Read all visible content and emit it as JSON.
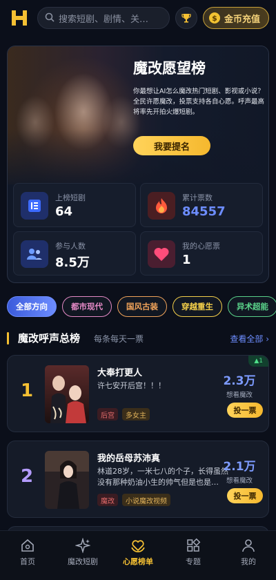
{
  "header": {
    "search_placeholder": "搜索短剧、剧情、关…",
    "coin_icon_text": "$",
    "coin_button_label": "金币充值"
  },
  "hero": {
    "title": "魔改愿望榜",
    "description": "你最想让AI怎么魔改热门短剧、影视或小说？全民许愿魔改，投票支持各自心愿。呼声最高将率先开拍火爆短剧。",
    "cta_label": "我要提名",
    "stats": [
      {
        "label": "上榜短剧",
        "value": "64",
        "icon": "list-icon"
      },
      {
        "label": "累计票数",
        "value": "84557",
        "icon": "fire-icon"
      },
      {
        "label": "参与人数",
        "value": "8.5万",
        "icon": "users-icon"
      },
      {
        "label": "我的心愿票",
        "value": "1",
        "icon": "heart-icon"
      }
    ]
  },
  "filters": {
    "chips": [
      {
        "label": "全部方向",
        "color": "#6d8dff"
      },
      {
        "label": "都市现代",
        "color": "#e58ac6"
      },
      {
        "label": "国风古装",
        "color": "#f0a35a"
      },
      {
        "label": "穿越重生",
        "color": "#f5d04a"
      },
      {
        "label": "异术超能",
        "color": "#5ad38a"
      }
    ],
    "selected": "全部方向"
  },
  "section": {
    "title": "魔改呼声总榜",
    "subtitle": "每条每天一票",
    "more_label": "查看全部",
    "more_arrow": "›"
  },
  "rankings": [
    {
      "rank": "1",
      "title": "大奉打更人",
      "description": "许七安开后宫！！！",
      "tags": [
        {
          "label": "后宫",
          "color": "#e06a6a",
          "bg": "#3a1c22"
        },
        {
          "label": "多女主",
          "color": "#e0b25a",
          "bg": "#3a2e1a"
        }
      ],
      "votes": "2.3万",
      "votes_label": "想看魔改",
      "vote_button": "投一票",
      "trend": "▲1",
      "rank_color": "#f5c033"
    },
    {
      "rank": "2",
      "title": "我的岳母苏沛真",
      "description": "林道28岁，一米七八的个子，长得虽然没有那种奶油小生的帅气但是也是…",
      "tags": [
        {
          "label": "魔改",
          "color": "#e06a6a",
          "bg": "#3a1c22"
        },
        {
          "label": "小说魔改视频",
          "color": "#e0b25a",
          "bg": "#3a2e1a"
        }
      ],
      "votes": "2.1万",
      "votes_label": "想看魔改",
      "vote_button": "投一票",
      "rank_color": "#b49cff"
    }
  ],
  "bottom_nav": [
    {
      "label": "首页",
      "icon": "home-icon",
      "active": false
    },
    {
      "label": "魔改短剧",
      "icon": "sparkle-icon",
      "active": false
    },
    {
      "label": "心愿榜单",
      "icon": "heart-hands-icon",
      "active": true
    },
    {
      "label": "专题",
      "icon": "grid-icon",
      "active": false
    },
    {
      "label": "我的",
      "icon": "profile-icon",
      "active": false
    }
  ]
}
